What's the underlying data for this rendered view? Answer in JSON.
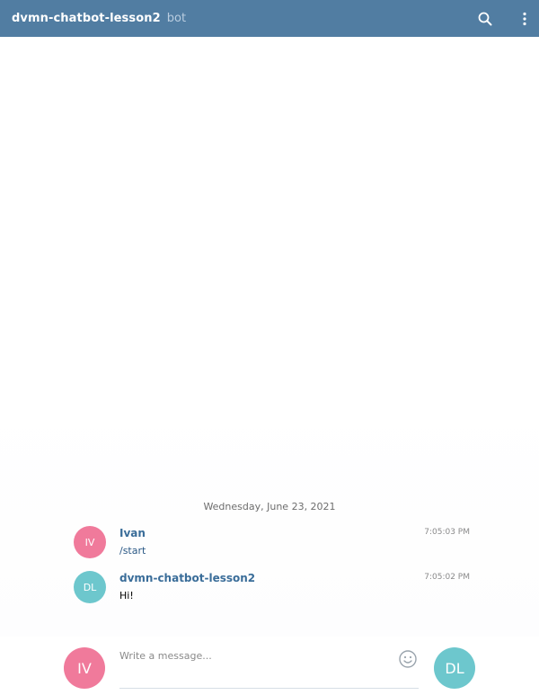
{
  "header": {
    "title": "dvmn-chatbot-lesson2",
    "subtitle": "bot",
    "background": "#517da2",
    "search_icon": "search-icon",
    "more_icon": "more-vertical-icon"
  },
  "date_separator": "Wednesday, June 23, 2021",
  "messages": [
    {
      "avatar_initials": "IV",
      "avatar_color": "#f07a9b",
      "author": "Ivan",
      "text": "/start",
      "time": "7:05:03 PM"
    },
    {
      "avatar_initials": "DL",
      "avatar_color": "#6dc7cd",
      "author": "dvmn-chatbot-lesson2",
      "text": "Hi!",
      "time": "7:05:02 PM"
    }
  ],
  "composer": {
    "left_avatar_initials": "IV",
    "left_avatar_color": "#f07a9b",
    "placeholder": "Write a message...",
    "emoji_icon": "smiley-icon",
    "right_avatar_initials": "DL",
    "right_avatar_color": "#6dc7cd"
  }
}
